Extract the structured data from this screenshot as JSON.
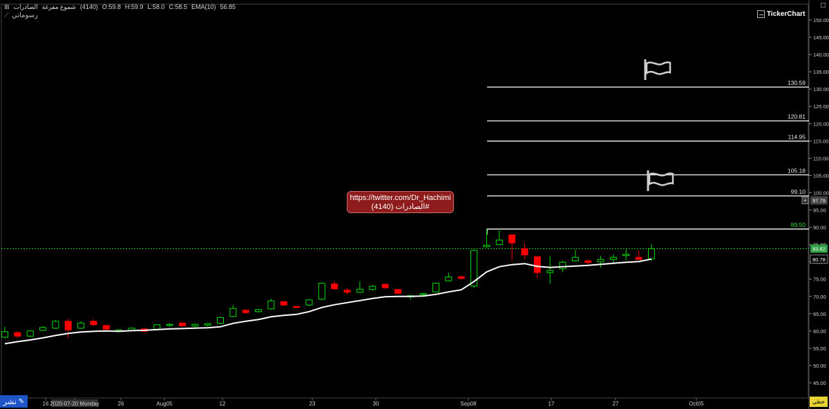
{
  "header": {
    "title_parts": [
      "الصادرات",
      "شموع مفرغة",
      "(4140)",
      "O:59.8",
      "H:59.9",
      "L:58.0",
      "C:58.5",
      "EMA(10)",
      "56.85"
    ],
    "drawings_label": "رسوماتي",
    "brand": "TickerChart"
  },
  "annotation": {
    "line1": "https://twitter.com/Dr_Hachimi",
    "line2": "#الصادرات (4140)"
  },
  "footer": {
    "publish_label": "نشر",
    "corner_label": "خطي"
  },
  "colors": {
    "background": "#000000",
    "up_candle": "#00e000",
    "down_candle": "#ff0000",
    "ema": "#ffffff",
    "axis_text": "#d0d0d0",
    "last_price_bg": "#2ea043",
    "level_label_highlight": "#35d835"
  },
  "chart_data": {
    "type": "candlestick",
    "x_labels": [
      "16",
      "2020-07-20 Monday",
      "26",
      "Aug05",
      "12",
      "23",
      "30",
      "Sep08",
      "17",
      "27",
      "Oct05"
    ],
    "ylim": [
      45,
      152.5
    ],
    "y_ticks": [
      "150.00",
      "145.00",
      "140.00",
      "135.00",
      "130.00",
      "125.00",
      "120.00",
      "115.00",
      "110.00",
      "105.00",
      "100.00",
      "95.00",
      "90.00",
      "85.00",
      "80.00",
      "75.00",
      "70.00",
      "65.00",
      "60.00",
      "55.00",
      "50.00",
      "45.00"
    ],
    "last_price": "83.82",
    "ema_value": "80.78",
    "cursor_value": "97.79",
    "levels": [
      {
        "value": 130.59,
        "label": "130.59"
      },
      {
        "value": 120.81,
        "label": "120.81"
      },
      {
        "value": 114.95,
        "label": "114.95"
      },
      {
        "value": 105.18,
        "label": "105.18"
      },
      {
        "value": 99.1,
        "label": "99.10"
      },
      {
        "value": 89.5,
        "label": "89.50"
      }
    ],
    "ohlc": [
      [
        58.2,
        61.2,
        57.9,
        59.8
      ],
      [
        59.5,
        60.0,
        58.0,
        58.5
      ],
      [
        58.5,
        60.2,
        58.3,
        60.0
      ],
      [
        60.2,
        61.4,
        59.9,
        61.0
      ],
      [
        60.8,
        63.1,
        60.6,
        62.8
      ],
      [
        62.8,
        63.5,
        58.0,
        60.3
      ],
      [
        60.8,
        62.8,
        60.6,
        62.3
      ],
      [
        62.8,
        63.4,
        61.5,
        61.8
      ],
      [
        61.6,
        61.7,
        60.3,
        60.5
      ],
      [
        60.0,
        60.5,
        59.8,
        60.3
      ],
      [
        60.1,
        61.0,
        59.9,
        60.8
      ],
      [
        60.6,
        60.9,
        59.6,
        59.9
      ],
      [
        60.5,
        62.0,
        60.2,
        61.8
      ],
      [
        61.6,
        62.3,
        61.2,
        61.9
      ],
      [
        62.3,
        62.6,
        61.3,
        61.5
      ],
      [
        61.4,
        62.2,
        61.1,
        61.9
      ],
      [
        61.7,
        62.3,
        61.3,
        62.1
      ],
      [
        62.2,
        64.2,
        62.0,
        63.9
      ],
      [
        64.2,
        67.5,
        64.0,
        66.5
      ],
      [
        66.0,
        66.2,
        65.0,
        65.3
      ],
      [
        65.6,
        66.4,
        65.3,
        66.2
      ],
      [
        66.4,
        69.3,
        66.2,
        68.7
      ],
      [
        68.5,
        68.6,
        67.2,
        67.5
      ],
      [
        67.1,
        67.2,
        66.6,
        66.8
      ],
      [
        67.5,
        69.2,
        67.3,
        69.0
      ],
      [
        69.2,
        74.0,
        69.0,
        73.8
      ],
      [
        73.6,
        74.3,
        71.9,
        72.2
      ],
      [
        71.8,
        72.4,
        70.6,
        71.2
      ],
      [
        71.2,
        74.4,
        71.0,
        72.1
      ],
      [
        72.0,
        73.3,
        71.7,
        72.9
      ],
      [
        73.5,
        73.7,
        72.2,
        72.5
      ],
      [
        72.0,
        72.1,
        70.6,
        70.9
      ],
      [
        70.1,
        70.4,
        69.1,
        70.2
      ],
      [
        70.6,
        71.0,
        70.2,
        70.8
      ],
      [
        71.3,
        74.0,
        71.2,
        73.8
      ],
      [
        74.5,
        76.9,
        74.3,
        75.6
      ],
      [
        75.7,
        76.0,
        74.9,
        75.2
      ],
      [
        73.0,
        83.5,
        72.5,
        83.3
      ],
      [
        84.4,
        89.5,
        84.1,
        84.8
      ],
      [
        85.0,
        89.1,
        84.8,
        86.3
      ],
      [
        87.8,
        88.0,
        80.4,
        85.5
      ],
      [
        83.8,
        85.3,
        80.7,
        82.0
      ],
      [
        81.5,
        81.6,
        75.3,
        76.9
      ],
      [
        76.9,
        81.6,
        73.7,
        77.5
      ],
      [
        78.0,
        80.4,
        77.0,
        79.9
      ],
      [
        80.3,
        83.5,
        80.1,
        81.3
      ],
      [
        80.3,
        80.6,
        79.4,
        79.8
      ],
      [
        80.0,
        81.7,
        78.3,
        80.7
      ],
      [
        80.7,
        82.2,
        79.4,
        81.3
      ],
      [
        81.8,
        83.6,
        80.5,
        82.2
      ],
      [
        81.3,
        83.3,
        80.9,
        80.7
      ],
      [
        80.9,
        85.1,
        80.3,
        83.8
      ]
    ],
    "ema": [
      56.3,
      56.9,
      57.4,
      58.0,
      58.7,
      59.3,
      59.7,
      59.9,
      60.0,
      59.9,
      60.1,
      60.2,
      60.4,
      60.6,
      60.7,
      60.8,
      60.9,
      61.2,
      62.2,
      62.8,
      63.3,
      64.1,
      64.5,
      64.8,
      65.6,
      66.8,
      67.6,
      68.2,
      68.8,
      69.4,
      69.9,
      70.0,
      70.0,
      70.1,
      70.6,
      71.3,
      71.9,
      74.3,
      77.1,
      78.6,
      79.2,
      79.5,
      78.7,
      78.4,
      78.6,
      78.8,
      79.0,
      79.3,
      79.6,
      79.9,
      80.1,
      80.8
    ]
  }
}
